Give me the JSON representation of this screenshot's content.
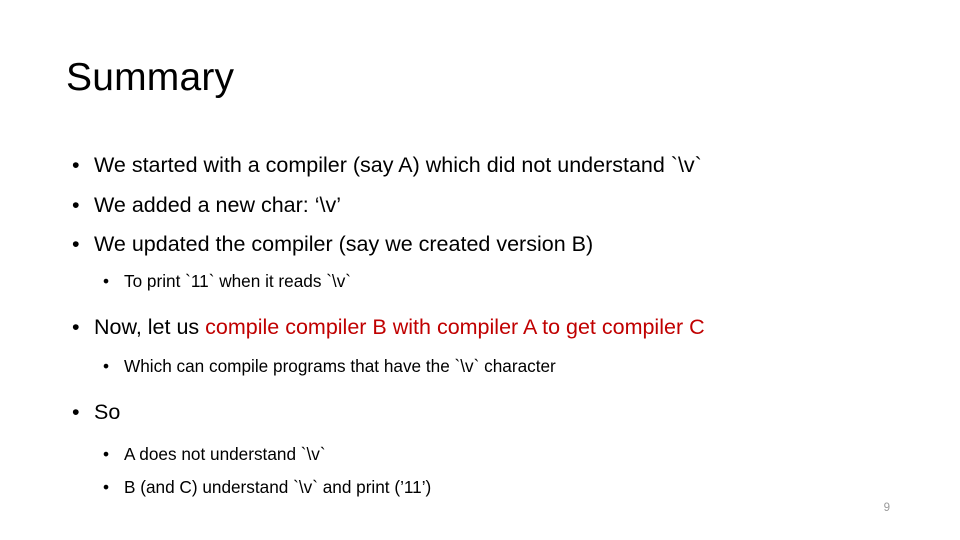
{
  "slide": {
    "title": "Summary",
    "page_number": "9",
    "accent_color": "#C00000",
    "text_color": "#000000",
    "background_color": "#FFFFFF",
    "bullet_marker": "•",
    "bullets": [
      {
        "level": 1,
        "text": "We started with a compiler (say A) which did not understand `\\v`"
      },
      {
        "level": 1,
        "text": "We added a new char: ‘\\v’"
      },
      {
        "level": 1,
        "text": "We updated the compiler (say we created version B)"
      },
      {
        "level": 2,
        "text": "To print `11` when it reads `\\v`"
      },
      {
        "level": 1,
        "text_plain": "Now, let us  ",
        "text_accent": "compile compiler B with compiler A to get compiler C"
      },
      {
        "level": 2,
        "text": "Which can compile  programs that have the `\\v` character"
      },
      {
        "level": 1,
        "text": "So"
      },
      {
        "level": 2,
        "text": "A does not understand `\\v`"
      },
      {
        "level": 2,
        "text": "B (and C) understand `\\v` and print (’11’)"
      }
    ]
  }
}
